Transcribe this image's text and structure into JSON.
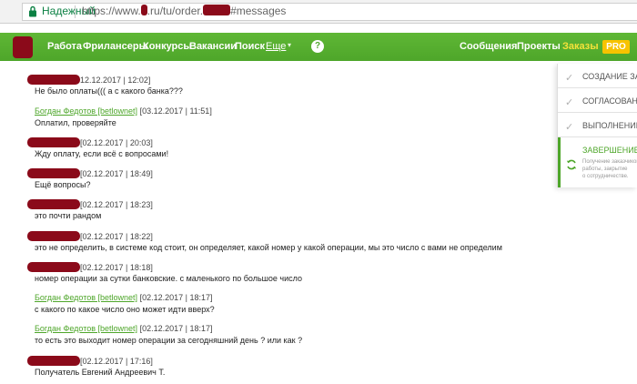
{
  "browser": {
    "secure_label": "Надежный",
    "url_prefix": "https://www.",
    "url_mid": ".ru/tu/order.",
    "url_suffix": "#messages"
  },
  "nav": {
    "items": [
      "Работа",
      "Фрилансеры",
      "Конкурсы",
      "Вакансии",
      "Поиск"
    ],
    "more": "Еще",
    "help": "?",
    "messages": "Сообщения",
    "projects": "Проекты",
    "orders": "Заказы",
    "pro": "PRO"
  },
  "messages": [
    {
      "author": "",
      "date": "12.12.2017 | 12:02]",
      "text": "Не было оплаты((( а с какого банка???"
    },
    {
      "author": "Богдан Федотов [betlownet]",
      "date": "[03.12.2017 | 11:51]",
      "text": "Оплатил, проверяйте"
    },
    {
      "author": "",
      "date": "[02.12.2017 | 20:03]",
      "text": "Жду оплату, если всё с вопросами!"
    },
    {
      "author": "",
      "date": "[02.12.2017 | 18:49]",
      "text": "Ещё вопросы?"
    },
    {
      "author": "",
      "date": "[02.12.2017 | 18:23]",
      "text": "это почти рандом"
    },
    {
      "author": "",
      "date": "[02.12.2017 | 18:22]",
      "text": "это не определить, в системе код стоит, он определяет, какой номер у какой операции, мы это число с вами не определим"
    },
    {
      "author": "",
      "date": "[02.12.2017 | 18:18]",
      "text": "номер операции за сутки банковские. с маленького по большое число"
    },
    {
      "author": "Богдан Федотов [betlownet]",
      "date": "[02.12.2017 | 18:17]",
      "text": "с какого по какое число оно может идти вверх?"
    },
    {
      "author": "Богдан Федотов [betlownet]",
      "date": "[02.12.2017 | 18:17]",
      "text": "то есть это выходит номер операции за сегодняшний день ? или как ?"
    },
    {
      "author": "",
      "date": "[02.12.2017 | 17:16]",
      "text": "Получатель Евгений Андреевич Т."
    }
  ],
  "panel": {
    "steps": [
      "СОЗДАНИЕ ЗАКАЗА",
      "СОГЛАСОВАНИЕ",
      "ВЫПОЛНЕНИЕ",
      "ЗАВЕРШЕНИЕ"
    ],
    "desc": [
      "Получение заказчиком",
      "работы, закрытие",
      "о сотрудничестве."
    ]
  },
  "colors": {
    "brand_green": "#4ea62a",
    "orders_yellow": "#f5e23a",
    "pro_badge": "#f7c300",
    "redaction": "#8b0a1a"
  }
}
